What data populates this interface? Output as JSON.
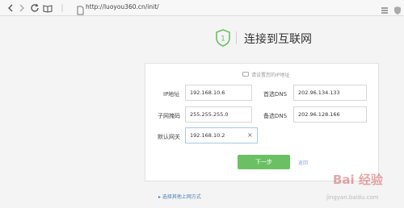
{
  "browser": {
    "url": "http://luoyou360.cn/init/",
    "icons": [
      "back-icon",
      "forward-icon",
      "refresh-icon",
      "book-icon",
      "page-icon",
      "menu-icon",
      "shield-icon"
    ]
  },
  "page": {
    "step_number": "1",
    "title": "连接到互联网",
    "hint": "请设置您的IP地址"
  },
  "form": {
    "ip_label": "IP地址",
    "ip_value": "192.168.10.6",
    "primary_dns_label": "首选DNS",
    "primary_dns_value": "202.96.134.133",
    "subnet_label": "子网掩码",
    "subnet_value": "255.255.255.0",
    "secondary_dns_label": "备选DNS",
    "secondary_dns_value": "202.96.128.166",
    "gateway_label": "默认网关",
    "gateway_value": "192.168.10.2",
    "clear_glyph": "×",
    "next_button": "下一步",
    "back_link": "返回"
  },
  "other_method_link": "选择其他上网方式",
  "watermark": {
    "text": "Bai 经验",
    "url": "jingyan.baidu.com"
  },
  "colors": {
    "accent_green": "#6ac063",
    "link_blue": "#4a7db0"
  }
}
